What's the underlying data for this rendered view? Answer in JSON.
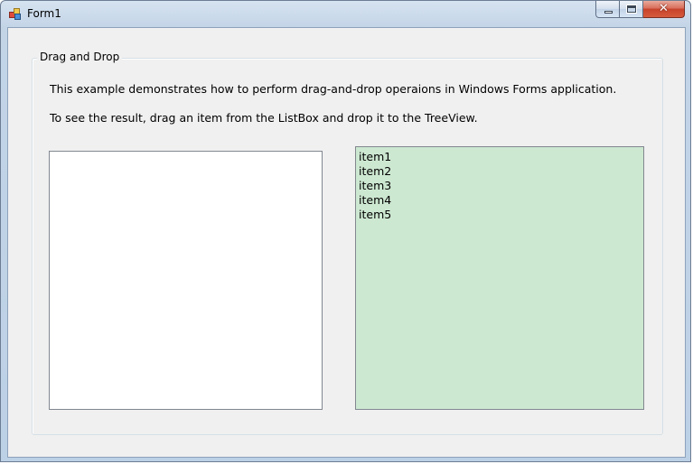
{
  "window": {
    "title": "Form1"
  },
  "caption_buttons": {
    "minimize_icon": "minimize-icon",
    "maximize_icon": "maximize-icon",
    "close_icon": "close-icon",
    "close_glyph": "✕"
  },
  "groupbox": {
    "title": "Drag and Drop",
    "description_line1": "This example demonstrates how to perform drag-and-drop operaions in Windows Forms application.",
    "description_line2": "To see the result, drag an item from the ListBox and drop it to the TreeView."
  },
  "treeview": {
    "nodes": []
  },
  "listbox": {
    "background_color": "#cde8d1",
    "items": [
      "item1",
      "item2",
      "item3",
      "item4",
      "item5"
    ]
  }
}
